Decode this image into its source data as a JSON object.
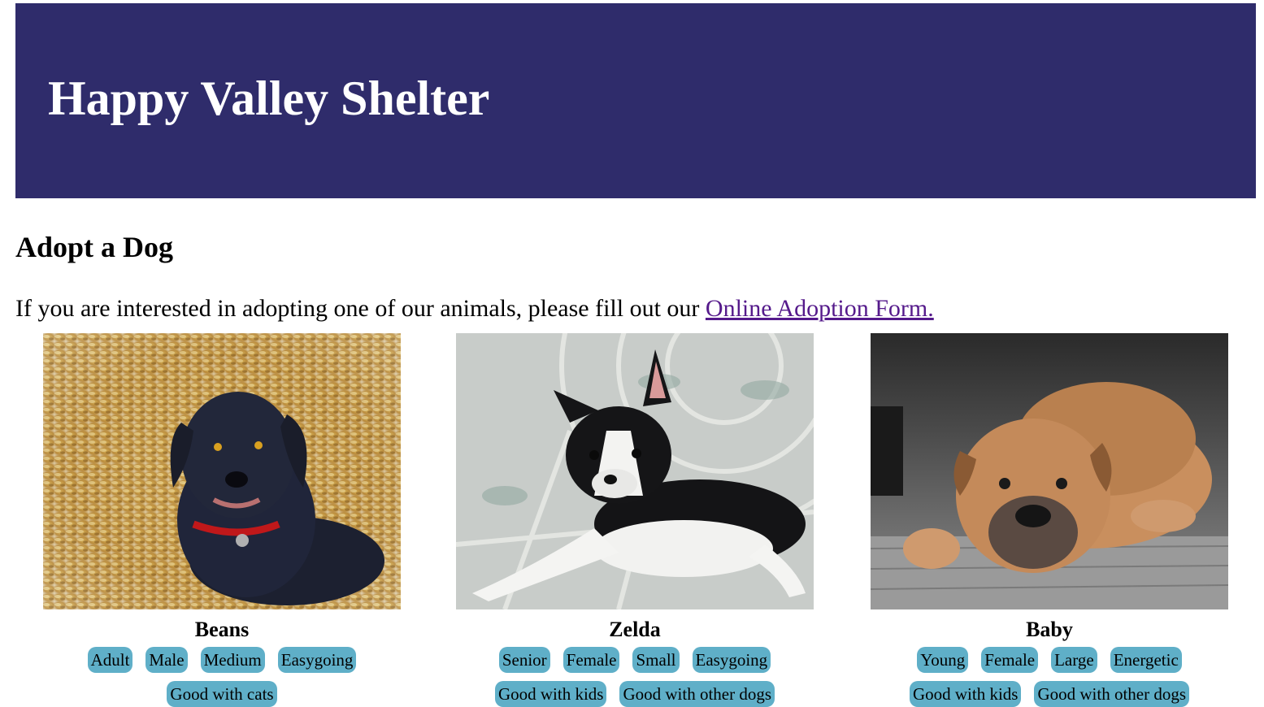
{
  "header": {
    "title": "Happy Valley Shelter",
    "background_color": "#2f2c6b"
  },
  "main": {
    "heading": "Adopt a Dog",
    "intro_text": "If you are interested in adopting one of our animals, please fill out our ",
    "link_text": "Online Adoption Form.",
    "link_color": "#551a8b"
  },
  "tag_color": "#5fafc8",
  "dogs": [
    {
      "name": "Beans",
      "photo": "black-scruffy-dog-lying-on-leaves",
      "tags": [
        "Adult",
        "Male",
        "Medium",
        "Easygoing",
        "Good with cats"
      ]
    },
    {
      "name": "Zelda",
      "photo": "boston-terrier-lying-on-tiles",
      "tags": [
        "Senior",
        "Female",
        "Small",
        "Easygoing",
        "Good with kids",
        "Good with other dogs"
      ]
    },
    {
      "name": "Baby",
      "photo": "tan-bulldog-lying-on-porch",
      "tags": [
        "Young",
        "Female",
        "Large",
        "Energetic",
        "Good with kids",
        "Good with other dogs"
      ]
    }
  ]
}
